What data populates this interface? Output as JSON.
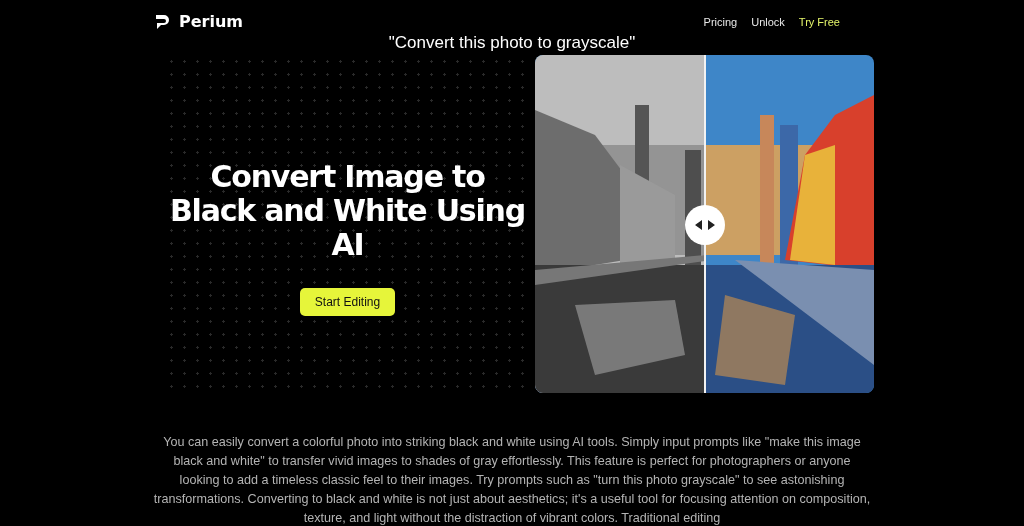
{
  "header": {
    "brand": "Perium",
    "nav": [
      {
        "label": "Pricing",
        "highlighted": false
      },
      {
        "label": "Unlock",
        "highlighted": false
      },
      {
        "label": "Try Free",
        "highlighted": true
      }
    ]
  },
  "prompt": "\"Convert this photo to grayscale\"",
  "hero": {
    "title": "Convert Image to Black and White Using AI",
    "button": "Start Editing",
    "comparison": {
      "kind": "picture",
      "level": 0.5
    }
  },
  "description": "You can easily convert a colorful photo into striking black and white using AI tools. Simply input prompts like \"make this image black and white\" to transfer vivid images to shades of gray effortlessly. This feature is perfect for photographers or anyone looking to add a timeless classic feel to their images. Try prompts such as \"turn this photo grayscale\" to see astonishing transformations. Converting to black and white is not just about aesthetics; it's a useful tool for focusing attention on composition, texture, and light without the distraction of vibrant colors. Traditional editing"
}
